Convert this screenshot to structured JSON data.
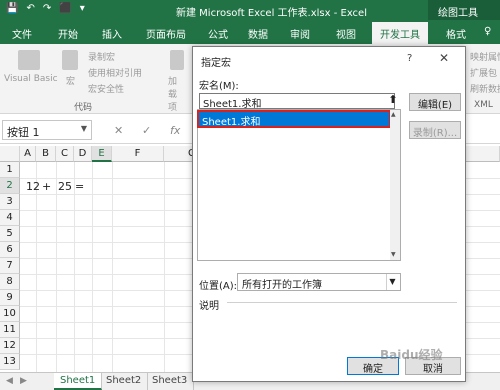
{
  "window": {
    "title": "新建 Microsoft Excel 工作表.xlsx  -  Excel",
    "context_tab": "绘图工具",
    "qat": [
      "💾",
      "↶",
      "↷",
      "⬛",
      "▾"
    ]
  },
  "tabs": [
    "文件",
    "开始",
    "插入",
    "页面布局",
    "公式",
    "数据",
    "审阅",
    "视图",
    "开发工具",
    "格式",
    "♀"
  ],
  "active_tab": "开发工具",
  "ribbon": {
    "visual_basic": "Visual Basic",
    "macros": "宏",
    "record_macro": "录制宏",
    "relative_ref": "使用相对引用",
    "macro_security": "宏安全性",
    "group_code": "代码",
    "addins": "加载项",
    "right_items": [
      "映射属性",
      "扩展包",
      "刷新数据"
    ],
    "xml": "XML"
  },
  "formula_bar": {
    "name_box": "按钮 1",
    "cancel": "✕",
    "enter": "✓",
    "fx": "fx"
  },
  "grid": {
    "columns": [
      "A",
      "B",
      "C",
      "D",
      "E",
      "F",
      "G"
    ],
    "rows": [
      "1",
      "2",
      "3",
      "4",
      "5",
      "6",
      "7",
      "8",
      "9",
      "10",
      "11",
      "12",
      "13"
    ],
    "cells": {
      "A2": "12",
      "B2": "+",
      "C2": "25",
      "D2": "="
    }
  },
  "sheets": [
    "Sheet1",
    "Sheet2",
    "Sheet3"
  ],
  "active_sheet": "Sheet1",
  "dialog": {
    "title": "指定宏",
    "help": "?",
    "close": "✕",
    "macro_name_label": "宏名(M):",
    "macro_name_value": "Sheet1.求和",
    "list_items": [
      "Sheet1.求和"
    ],
    "edit_button": "编辑(E)",
    "record_button": "录制(R)...",
    "location_label": "位置(A):",
    "location_value": "所有打开的工作簿",
    "description_label": "说明",
    "ok_button": "确定",
    "cancel_button": "取消"
  },
  "watermark": "Baidu经验",
  "colors": {
    "excel_green": "#217346",
    "selection_blue": "#0078d7",
    "highlight_red": "#d9221c"
  }
}
